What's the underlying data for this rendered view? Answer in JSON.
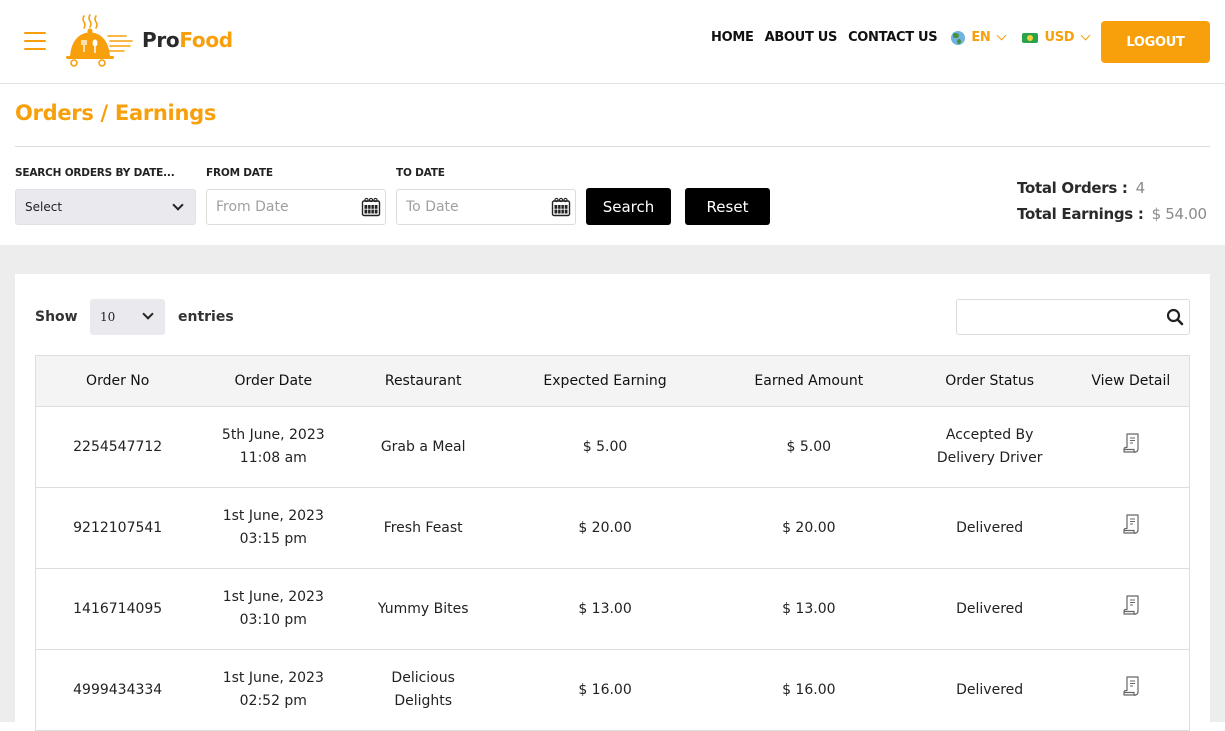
{
  "header": {
    "brand": {
      "pro": "Pro",
      "food": "Food"
    },
    "nav": [
      {
        "label": "HOME"
      },
      {
        "label": "ABOUT US"
      },
      {
        "label": "CONTACT US"
      }
    ],
    "language": {
      "icon": "globe-icon",
      "label": "EN"
    },
    "currency": {
      "icon": "money-icon",
      "label": "USD"
    },
    "logout_label": "LOGOUT"
  },
  "page": {
    "title": "Orders / Earnings"
  },
  "filters": {
    "search_by_label": "SEARCH ORDERS BY DATE...",
    "search_by_value": "Select",
    "from_label": "FROM DATE",
    "from_placeholder": "From Date",
    "to_label": "TO DATE",
    "to_placeholder": "To Date",
    "search_button": "Search",
    "reset_button": "Reset"
  },
  "summary": {
    "total_orders_label": "Total Orders :",
    "total_orders_value": "4",
    "total_earnings_label": "Total Earnings :",
    "total_earnings_value": "$ 54.00"
  },
  "table_controls": {
    "show_label": "Show",
    "entries_value": "10",
    "entries_label": "entries",
    "search_value": ""
  },
  "table": {
    "columns": [
      "Order No",
      "Order Date",
      "Restaurant",
      "Expected Earning",
      "Earned Amount",
      "Order Status",
      "View Detail"
    ],
    "rows": [
      {
        "order_no": "2254547712",
        "date": "5th June, 2023",
        "time": "11:08 am",
        "restaurant": "Grab a Meal",
        "expected": "$ 5.00",
        "earned": "$ 5.00",
        "status": "Accepted By Delivery Driver"
      },
      {
        "order_no": "9212107541",
        "date": "1st June, 2023",
        "time": "03:15 pm",
        "restaurant": "Fresh Feast",
        "expected": "$ 20.00",
        "earned": "$ 20.00",
        "status": "Delivered"
      },
      {
        "order_no": "1416714095",
        "date": "1st June, 2023",
        "time": "03:10 pm",
        "restaurant": "Yummy Bites",
        "expected": "$ 13.00",
        "earned": "$ 13.00",
        "status": "Delivered"
      },
      {
        "order_no": "4999434334",
        "date": "1st June, 2023",
        "time": "02:52 pm",
        "restaurant": "Delicious Delights",
        "expected": "$ 16.00",
        "earned": "$ 16.00",
        "status": "Delivered"
      }
    ]
  },
  "colors": {
    "accent": "#f7a00c",
    "button_dark": "#000000",
    "background_gray": "#ededed"
  }
}
